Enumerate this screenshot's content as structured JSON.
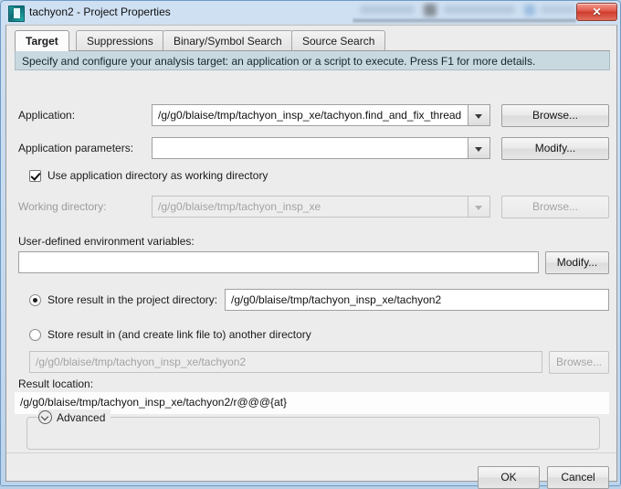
{
  "window": {
    "title": "tachyon2 - Project Properties",
    "app_icon": "inspector-app-icon",
    "close_label": "✕",
    "accent_blue": "#bcd4ec",
    "hint_bg": "#c9d9e0"
  },
  "tabs": [
    {
      "label": "Target",
      "selected": true
    },
    {
      "label": "Suppressions",
      "selected": false
    },
    {
      "label": "Binary/Symbol Search",
      "selected": false
    },
    {
      "label": "Source Search",
      "selected": false
    }
  ],
  "hint": "Specify and configure your analysis target: an application or a script to execute. Press F1 for more details.",
  "form": {
    "application": {
      "label": "Application:",
      "value": "/g/g0/blaise/tmp/tachyon_insp_xe/tachyon.find_and_fix_thread",
      "placeholder": "",
      "browse_label": "Browse..."
    },
    "application_parameters": {
      "label": "Application parameters:",
      "value": "",
      "placeholder": "",
      "modify_label": "Modify..."
    },
    "use_app_dir": {
      "label": "Use application directory as working directory",
      "checked": true
    },
    "working_directory": {
      "label": "Working directory:",
      "value": "/g/g0/blaise/tmp/tachyon_insp_xe",
      "browse_label": "Browse...",
      "disabled": true
    },
    "env_vars": {
      "label": "User-defined environment variables:",
      "value": "",
      "placeholder": "",
      "modify_label": "Modify..."
    },
    "store_project": {
      "label": "Store result in the project directory:",
      "selected": true,
      "value": "/g/g0/blaise/tmp/tachyon_insp_xe/tachyon2"
    },
    "store_other": {
      "label": "Store result in (and create link file to) another directory",
      "selected": false,
      "value": "/g/g0/blaise/tmp/tachyon_insp_xe/tachyon2",
      "browse_label": "Browse...",
      "disabled": true
    },
    "result_location": {
      "label": "Result location:",
      "value": "/g/g0/blaise/tmp/tachyon_insp_xe/tachyon2/r@@@{at}"
    },
    "advanced": {
      "label": "Advanced",
      "expanded": false,
      "icon": "chevron-down-circle-icon"
    }
  },
  "buttons": {
    "ok": "OK",
    "cancel": "Cancel"
  }
}
